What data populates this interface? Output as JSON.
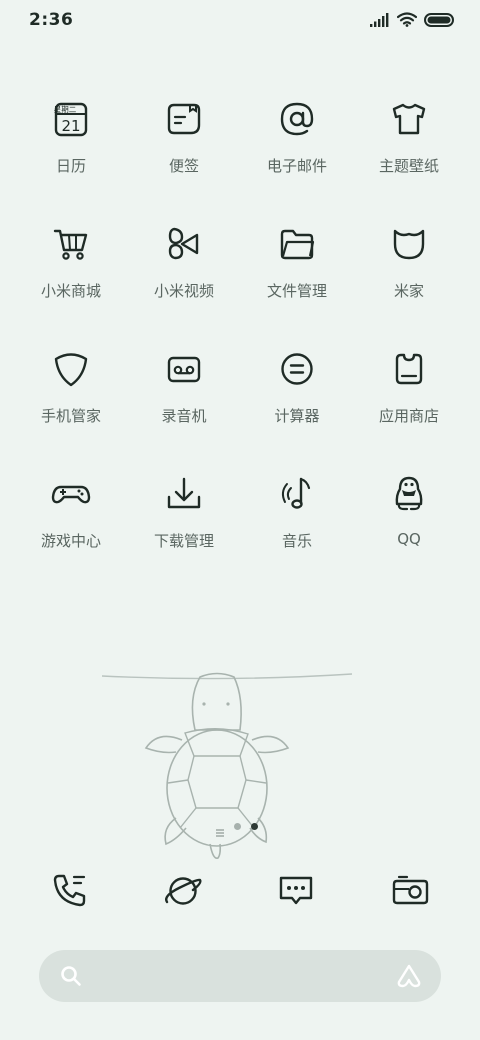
{
  "status_bar": {
    "time": "2:36"
  },
  "calendar_icon": {
    "weekday": "星期二",
    "day": "21"
  },
  "apps": [
    {
      "label": "日历",
      "icon": "calendar-icon"
    },
    {
      "label": "便签",
      "icon": "notes-icon"
    },
    {
      "label": "电子邮件",
      "icon": "email-icon"
    },
    {
      "label": "主题壁纸",
      "icon": "themes-icon"
    },
    {
      "label": "小米商城",
      "icon": "cart-icon"
    },
    {
      "label": "小米视频",
      "icon": "video-icon"
    },
    {
      "label": "文件管理",
      "icon": "folder-icon"
    },
    {
      "label": "米家",
      "icon": "mijia-icon"
    },
    {
      "label": "手机管家",
      "icon": "shield-icon"
    },
    {
      "label": "录音机",
      "icon": "recorder-icon"
    },
    {
      "label": "计算器",
      "icon": "calculator-icon"
    },
    {
      "label": "应用商店",
      "icon": "app-store-icon"
    },
    {
      "label": "游戏中心",
      "icon": "gamepad-icon"
    },
    {
      "label": "下载管理",
      "icon": "download-icon"
    },
    {
      "label": "音乐",
      "icon": "music-icon"
    },
    {
      "label": "QQ",
      "icon": "qq-penguin-icon"
    }
  ],
  "dock": [
    {
      "icon": "phone-icon"
    },
    {
      "icon": "browser-planet-icon"
    },
    {
      "icon": "messages-icon"
    },
    {
      "icon": "camera-icon"
    }
  ],
  "page_indicator": {
    "pages": 2,
    "active_page": 2
  },
  "search": {
    "placeholder": ""
  },
  "colors": {
    "background": "#eef4f1",
    "icon_stroke": "#1f2b26",
    "label_text": "#5a6661",
    "search_bar": "#d9e1dd"
  }
}
